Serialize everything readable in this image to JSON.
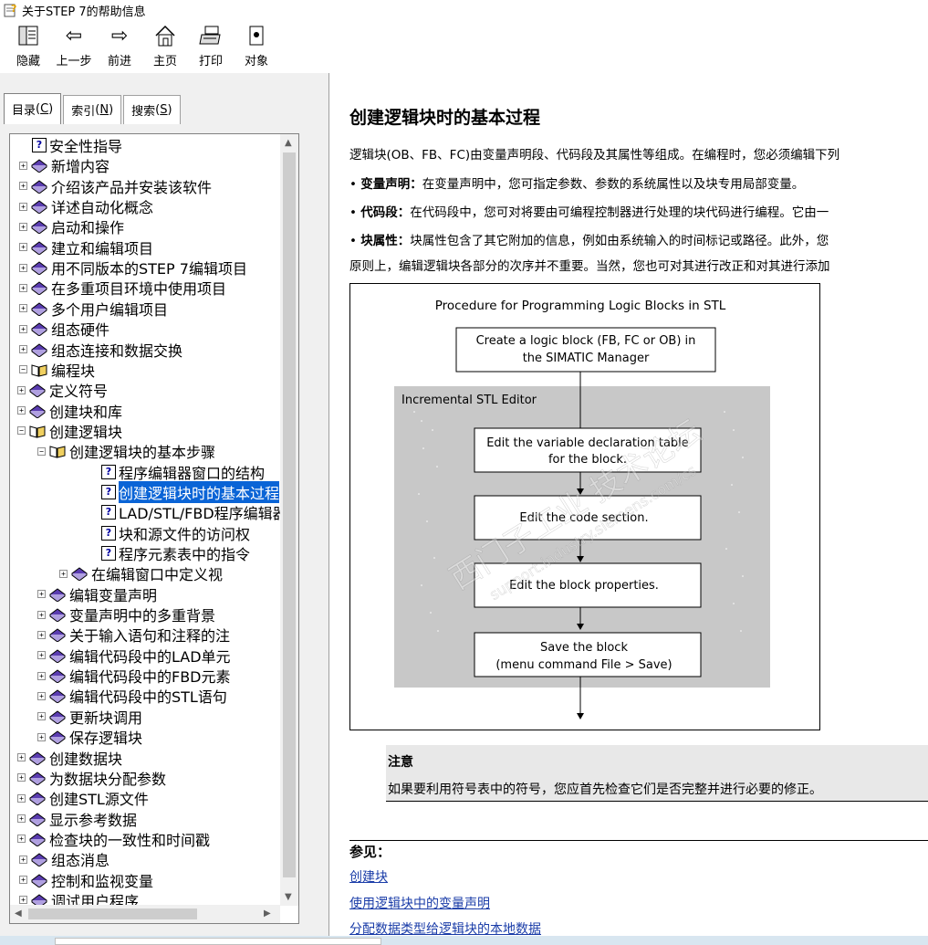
{
  "window": {
    "title": "关于STEP 7的帮助信息"
  },
  "toolbar": [
    {
      "label": "隐藏",
      "icon": "hide-icon"
    },
    {
      "label": "上一步",
      "icon": "back-arrow-icon"
    },
    {
      "label": "前进",
      "icon": "forward-arrow-icon"
    },
    {
      "label": "主页",
      "icon": "home-icon"
    },
    {
      "label": "打印",
      "icon": "print-icon"
    },
    {
      "label": "对象",
      "icon": "object-icon"
    }
  ],
  "tabs": [
    {
      "label": "目录",
      "key": "C"
    },
    {
      "label": "索引",
      "key": "N"
    },
    {
      "label": "搜索",
      "key": "S"
    }
  ],
  "tree": [
    {
      "level": 1,
      "type": "topic",
      "label": "安全性指导"
    },
    {
      "level": 0,
      "type": "book",
      "label": "新增内容"
    },
    {
      "level": 0,
      "type": "book",
      "label": "介绍该产品并安装该软件"
    },
    {
      "level": 0,
      "type": "book",
      "label": "详述自动化概念"
    },
    {
      "level": 0,
      "type": "book",
      "label": "启动和操作"
    },
    {
      "level": 0,
      "type": "book",
      "label": "建立和编辑项目"
    },
    {
      "level": 0,
      "type": "book",
      "label": "用不同版本的STEP 7编辑项目"
    },
    {
      "level": 0,
      "type": "book",
      "label": "在多重项目环境中使用项目"
    },
    {
      "level": 0,
      "type": "book",
      "label": "多个用户编辑项目"
    },
    {
      "level": 0,
      "type": "book",
      "label": "组态硬件"
    },
    {
      "level": 0,
      "type": "book",
      "label": "组态连接和数据交换"
    },
    {
      "level": 0,
      "type": "openbook",
      "label": "编程块"
    },
    {
      "level": 1,
      "type": "book",
      "label": "定义符号"
    },
    {
      "level": 1,
      "type": "book",
      "label": "创建块和库"
    },
    {
      "level": 1,
      "type": "openbook",
      "label": "创建逻辑块"
    },
    {
      "level": 2,
      "type": "openbook",
      "label": "创建逻辑块的基本步骤"
    },
    {
      "level": 3,
      "type": "topic",
      "label": "程序编辑器窗口的结构"
    },
    {
      "level": 3,
      "type": "topic",
      "label": "创建逻辑块时的基本过程",
      "selected": true
    },
    {
      "level": 3,
      "type": "topic",
      "label": "LAD/STL/FBD程序编辑器"
    },
    {
      "level": 3,
      "type": "topic",
      "label": "块和源文件的访问权"
    },
    {
      "level": 3,
      "type": "topic",
      "label": "程序元素表中的指令"
    },
    {
      "level": 3,
      "type": "book",
      "label": "在编辑窗口中定义视"
    },
    {
      "level": 2,
      "type": "book",
      "label": "编辑变量声明"
    },
    {
      "level": 2,
      "type": "book",
      "label": "变量声明中的多重背景"
    },
    {
      "level": 2,
      "type": "book",
      "label": "关于输入语句和注释的注"
    },
    {
      "level": 2,
      "type": "book",
      "label": "编辑代码段中的LAD单元"
    },
    {
      "level": 2,
      "type": "book",
      "label": "编辑代码段中的FBD元素"
    },
    {
      "level": 2,
      "type": "book",
      "label": "编辑代码段中的STL语句"
    },
    {
      "level": 2,
      "type": "book",
      "label": "更新块调用"
    },
    {
      "level": 2,
      "type": "book",
      "label": "保存逻辑块"
    },
    {
      "level": 1,
      "type": "book",
      "label": "创建数据块"
    },
    {
      "level": 1,
      "type": "book",
      "label": "为数据块分配参数"
    },
    {
      "level": 1,
      "type": "book",
      "label": "创建STL源文件"
    },
    {
      "level": 1,
      "type": "book",
      "label": "显示参考数据"
    },
    {
      "level": 1,
      "type": "book",
      "label": "检查块的一致性和时间戳"
    },
    {
      "level": 0,
      "type": "book",
      "label": "组态消息"
    },
    {
      "level": 0,
      "type": "book",
      "label": "控制和监视变量"
    },
    {
      "level": 0,
      "type": "book",
      "label": "调试用户程序"
    }
  ],
  "content": {
    "title": "创建逻辑块时的基本过程",
    "intro": "逻辑块(OB、FB、FC)由变量声明段、代码段及其属性等组成。在编程时，您必须编辑下列",
    "bullets": [
      {
        "term": "变量声明：",
        "text": "在变量声明中，您可指定参数、参数的系统属性以及块专用局部变量。"
      },
      {
        "term": "代码段：",
        "text": "在代码段中，您可对将要由可编程控制器进行处理的块代码进行编程。它由一"
      },
      {
        "term": "块属性：",
        "text": "块属性包含了其它附加的信息，例如由系统输入的时间标记或路径。此外，您"
      }
    ],
    "closing": "原则上，编辑逻辑块各部分的次序并不重要。当然，您也可对其进行改正和对其进行添加",
    "diagram": {
      "title": "Procedure for Programming Logic Blocks in STL",
      "step1": "Create a logic block (FB, FC or OB) in the SIMATIC Manager",
      "step1_l1": "Create a logic block (FB, FC or OB) in",
      "step1_l2": "the SIMATIC Manager",
      "editor_label": "Incremental STL Editor",
      "step2_l1": "Edit the variable declaration table",
      "step2_l2": "for the block.",
      "step3": "Edit the code section.",
      "step4": "Edit the block properties.",
      "step5_l1": "Save the block",
      "step5_l2": "(menu command File > Save)",
      "watermark_l1": "西门子工业 技术论坛",
      "watermark_l2": "support.industry.siemens.com/cs"
    },
    "note": {
      "title": "注意",
      "body": "如果要利用符号表中的符号，您应首先检查它们是否完整并进行必要的修正。"
    },
    "seealso": {
      "title": "参见：",
      "links": [
        "创建块",
        "使用逻辑块中的变量声明",
        "分配数据类型给逻辑块的本地数据"
      ]
    }
  },
  "colors": {
    "selection": "#0a64d6",
    "link": "#1a3ca8",
    "panel": "#f0f0f0",
    "diagram_gray": "#c8c8c8"
  }
}
